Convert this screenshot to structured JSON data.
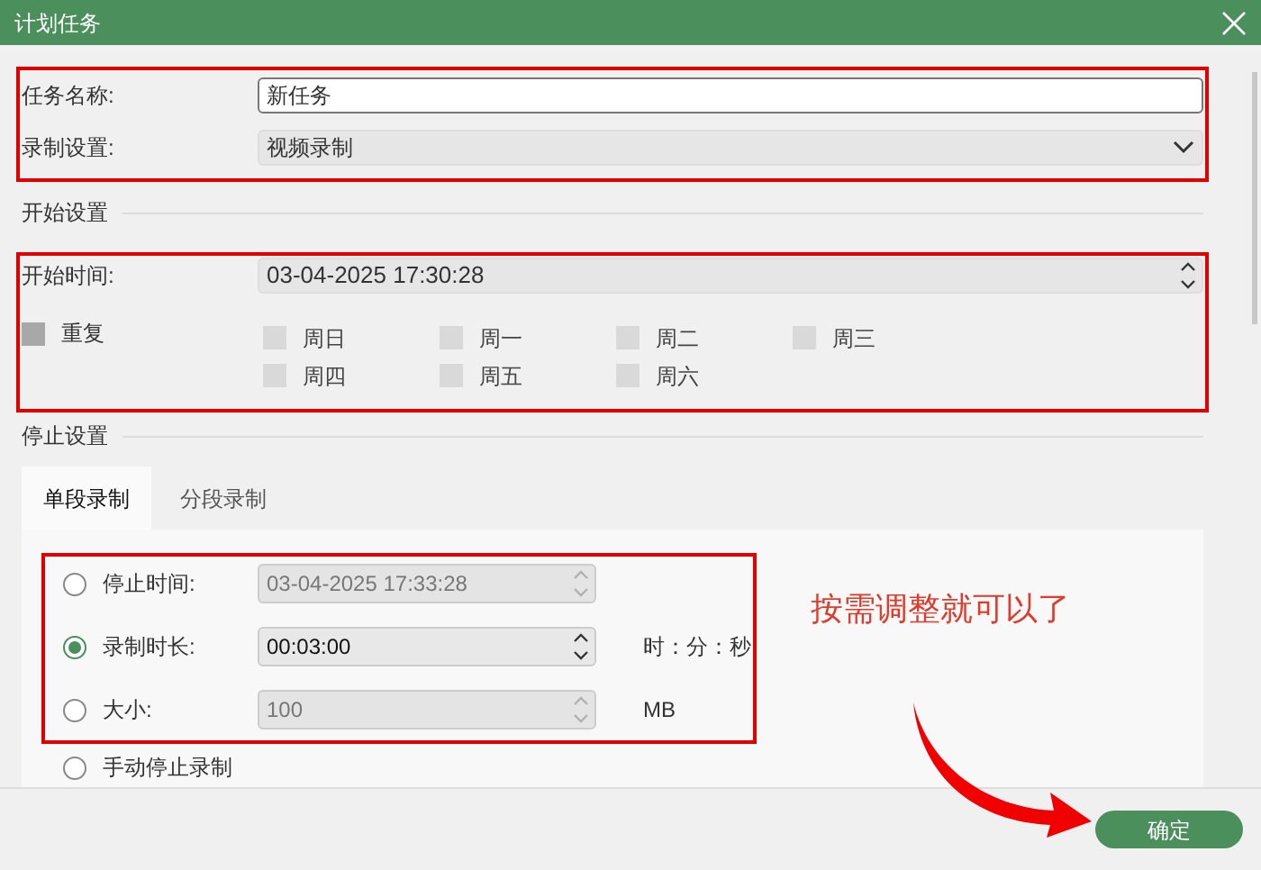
{
  "window": {
    "title": "计划任务"
  },
  "task_name": {
    "label": "任务名称:",
    "value": "新任务"
  },
  "record_setting": {
    "label": "录制设置:",
    "value": "视频录制"
  },
  "start_section": {
    "title": "开始设置",
    "start_time": {
      "label": "开始时间:",
      "value": "03-04-2025 17:30:28"
    },
    "repeat": {
      "label": "重复",
      "checked": false
    },
    "days": [
      {
        "label": "周日",
        "checked": false,
        "disabled": true
      },
      {
        "label": "周一",
        "checked": false,
        "disabled": true
      },
      {
        "label": "周二",
        "checked": false,
        "disabled": true
      },
      {
        "label": "周三",
        "checked": false,
        "disabled": true
      },
      {
        "label": "周四",
        "checked": false,
        "disabled": true
      },
      {
        "label": "周五",
        "checked": false,
        "disabled": true
      },
      {
        "label": "周六",
        "checked": false,
        "disabled": true
      }
    ]
  },
  "stop_section": {
    "title": "停止设置",
    "tabs": [
      {
        "label": "单段录制",
        "selected": true
      },
      {
        "label": "分段录制",
        "selected": false
      }
    ],
    "options": [
      {
        "kind": "field",
        "label": "停止时间:",
        "value": "03-04-2025 17:33:28",
        "selected": false,
        "disabled": true
      },
      {
        "kind": "field",
        "label": "录制时长:",
        "value": "00:03:00",
        "unit": "时：分：秒",
        "selected": true,
        "disabled": false
      },
      {
        "kind": "field",
        "label": "大小:",
        "value": "100",
        "unit": "MB",
        "selected": false,
        "disabled": true
      },
      {
        "kind": "plain",
        "label": "手动停止录制",
        "selected": false
      }
    ]
  },
  "annotation": {
    "text": "按需调整就可以了"
  },
  "buttons": [
    {
      "label": "确定"
    }
  ]
}
